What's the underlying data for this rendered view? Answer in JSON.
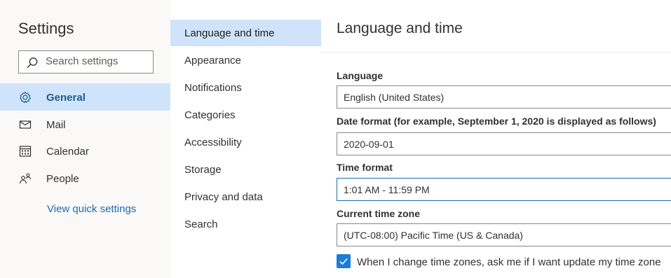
{
  "sidebar": {
    "title": "Settings",
    "search_placeholder": "Search settings",
    "items": [
      {
        "label": "General",
        "icon": "gear-icon",
        "selected": true
      },
      {
        "label": "Mail",
        "icon": "mail-icon",
        "selected": false
      },
      {
        "label": "Calendar",
        "icon": "calendar-icon",
        "selected": false
      },
      {
        "label": "People",
        "icon": "people-icon",
        "selected": false
      }
    ],
    "quick_settings_link": "View quick settings"
  },
  "subnav": {
    "items": [
      {
        "label": "Language and time",
        "selected": true
      },
      {
        "label": "Appearance",
        "selected": false
      },
      {
        "label": "Notifications",
        "selected": false
      },
      {
        "label": "Categories",
        "selected": false
      },
      {
        "label": "Accessibility",
        "selected": false
      },
      {
        "label": "Storage",
        "selected": false
      },
      {
        "label": "Privacy and data",
        "selected": false
      },
      {
        "label": "Search",
        "selected": false
      }
    ]
  },
  "main": {
    "title": "Language and time",
    "language": {
      "label": "Language",
      "value": "English (United States)"
    },
    "date_format": {
      "label": "Date format (for example, September 1, 2020 is displayed as follows)",
      "value": "2020-09-01"
    },
    "time_format": {
      "label": "Time format",
      "value": "1:01 AM - 11:59 PM"
    },
    "time_zone": {
      "label": "Current time zone",
      "value": "(UTC-08:00) Pacific Time (US & Canada)"
    },
    "tz_prompt": {
      "label": "When I change time zones, ask me if I want update my time zone",
      "checked": true
    }
  },
  "colors": {
    "accent": "#1c7cd6",
    "selected_bg": "#cfe4fa",
    "link": "#1c6cb0"
  }
}
